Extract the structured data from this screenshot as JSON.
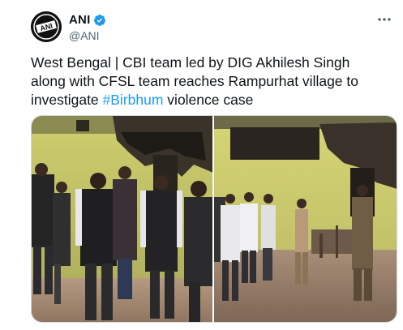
{
  "account": {
    "display_name": "ANI",
    "handle": "@ANI",
    "avatar_text": "ANI",
    "verified": true
  },
  "tweet": {
    "text_before": "West Bengal | CBI team led by DIG Akhilesh Singh along with CFSL team reaches Rampurhat village to investigate ",
    "hashtag": "#Birbhum",
    "text_after": " violence case"
  },
  "colors": {
    "verified_blue": "#1d9bf0",
    "hashtag_blue": "#1d9bf0",
    "handle_gray": "#536471",
    "wall_yellow": "#d4d36b"
  },
  "media": {
    "photos": [
      {
        "label": "photo-1"
      },
      {
        "label": "photo-2"
      }
    ]
  },
  "icons": {
    "more": "more-options-icon",
    "verified": "verified-badge-icon"
  }
}
